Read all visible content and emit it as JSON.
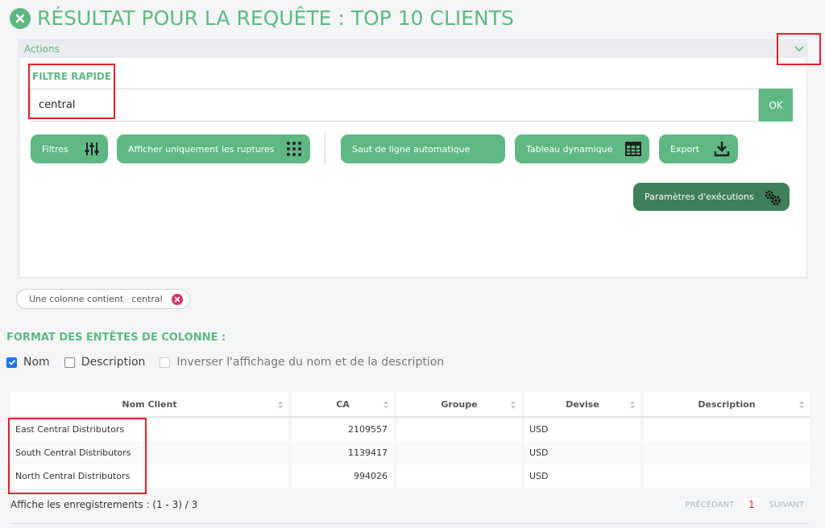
{
  "page": {
    "title": "RÉSULTAT POUR LA REQUÊTE : TOP 10 CLIENTS"
  },
  "actions": {
    "title": "Actions",
    "filter_label": "FILTRE RAPIDE",
    "filter_value": "central",
    "ok_label": "OK",
    "buttons": {
      "filtres": "Filtres",
      "ruptures": "Afficher uniquement les ruptures",
      "saut_ligne": "Saut de ligne automatique",
      "tableau": "Tableau dynamique",
      "export": "Export",
      "parametres": "Paramètres d'exécutions"
    }
  },
  "chip": {
    "text": "Une colonne contient",
    "value": "central"
  },
  "format": {
    "title": "FORMAT DES ENTÊTES DE COLONNE :",
    "nom": "Nom",
    "description": "Description",
    "inverser": "Inverser l'affichage du nom et de la description",
    "nom_checked": true,
    "description_checked": false,
    "inverser_disabled": true
  },
  "table": {
    "headers": [
      "Nom Client",
      "CA",
      "Groupe",
      "Devise",
      "Description"
    ],
    "rows": [
      [
        "East Central Distributors",
        "2109557",
        "",
        "USD",
        ""
      ],
      [
        "South Central Distributors",
        "1139417",
        "",
        "USD",
        ""
      ],
      [
        "North Central Distributors",
        "994026",
        "",
        "USD",
        ""
      ]
    ]
  },
  "footer": {
    "records": "Affiche les enregistrements : (1 - 3) / 3",
    "prev": "PRÉCÉDANT",
    "page": "1",
    "next": "SUIVANT"
  },
  "colors": {
    "accent": "#5fb884",
    "accent_dark": "#3f7f59",
    "highlight": "#e0202a",
    "chip_close": "#d6336c"
  }
}
